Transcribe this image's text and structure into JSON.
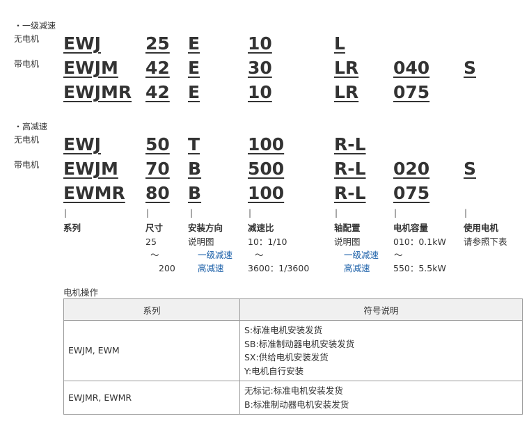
{
  "section1": {
    "title": "・一级减速",
    "row_labels": [
      "无电机",
      "带电机"
    ],
    "rows": [
      [
        "EWJ",
        "25",
        "E",
        "10",
        "L",
        "",
        ""
      ],
      [
        "EWJM",
        "42",
        "E",
        "30",
        "LR",
        "040",
        "S"
      ],
      [
        "EWJMR",
        "42",
        "E",
        "10",
        "LR",
        "075",
        ""
      ]
    ]
  },
  "section2": {
    "title": "・高减速",
    "row_labels": [
      "无电机",
      "带电机"
    ],
    "rows": [
      [
        "EWJ",
        "50",
        "T",
        "100",
        "R-L",
        "",
        ""
      ],
      [
        "EWJM",
        "70",
        "B",
        "500",
        "R-L",
        "020",
        "S"
      ],
      [
        "EWMR",
        "80",
        "B",
        "100",
        "R-L",
        "075",
        ""
      ]
    ]
  },
  "legend": {
    "pipe": "|",
    "series": {
      "label": "系列"
    },
    "size": {
      "label": "尺寸",
      "line1": "25",
      "line2": "～",
      "line3": "200"
    },
    "mount": {
      "label": "安装方向",
      "line1": "说明图",
      "link1": "一级减速",
      "link2": "高减速"
    },
    "ratio": {
      "label": "减速比",
      "line1": "10：1/10",
      "line2": "～",
      "line3": "3600：1/3600"
    },
    "shaft": {
      "label": "轴配置",
      "line1": "说明图",
      "link1": "一级减速",
      "link2": "高减速"
    },
    "capacity": {
      "label": "电机容量",
      "line1": "010：0.1kW",
      "line2": "～",
      "line3": "550：5.5kW"
    },
    "motor": {
      "label": "使用电机",
      "line1": "请参照下表"
    }
  },
  "motor_ops": {
    "title": "电机操作",
    "headers": [
      "系列",
      "符号说明"
    ],
    "rows": [
      {
        "series": "EWJM, EWM",
        "lines": [
          "S:标准电机安装发货",
          "SB:标准制动器电机安装发货",
          "SX:供给电机安装发货",
          "Y:电机自行安装"
        ]
      },
      {
        "series": "EWJMR, EWMR",
        "lines": [
          "无标记:标准电机安装发货",
          "B:标准制动器电机安装发货"
        ]
      }
    ]
  },
  "colors": {
    "link": "#1a5fa8",
    "header_bg": "#f0f0f0",
    "border": "#9a9a9a"
  }
}
